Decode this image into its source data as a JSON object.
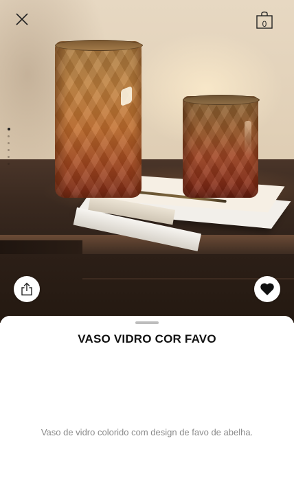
{
  "header": {
    "close_icon": "close-icon",
    "cart_icon": "shopping-bag-icon",
    "cart_count": "0"
  },
  "gallery": {
    "image_count": 6,
    "active_index": 0
  },
  "actions": {
    "share_icon": "share-icon",
    "favorite_icon": "heart-icon"
  },
  "product": {
    "name": "VASO VIDRO COR FAVO",
    "description": "Vaso de vidro colorido com design de favo de abelha."
  },
  "colors": {
    "text_primary": "#111111",
    "text_secondary": "#8a8a8a",
    "sheet_background": "#ffffff"
  }
}
